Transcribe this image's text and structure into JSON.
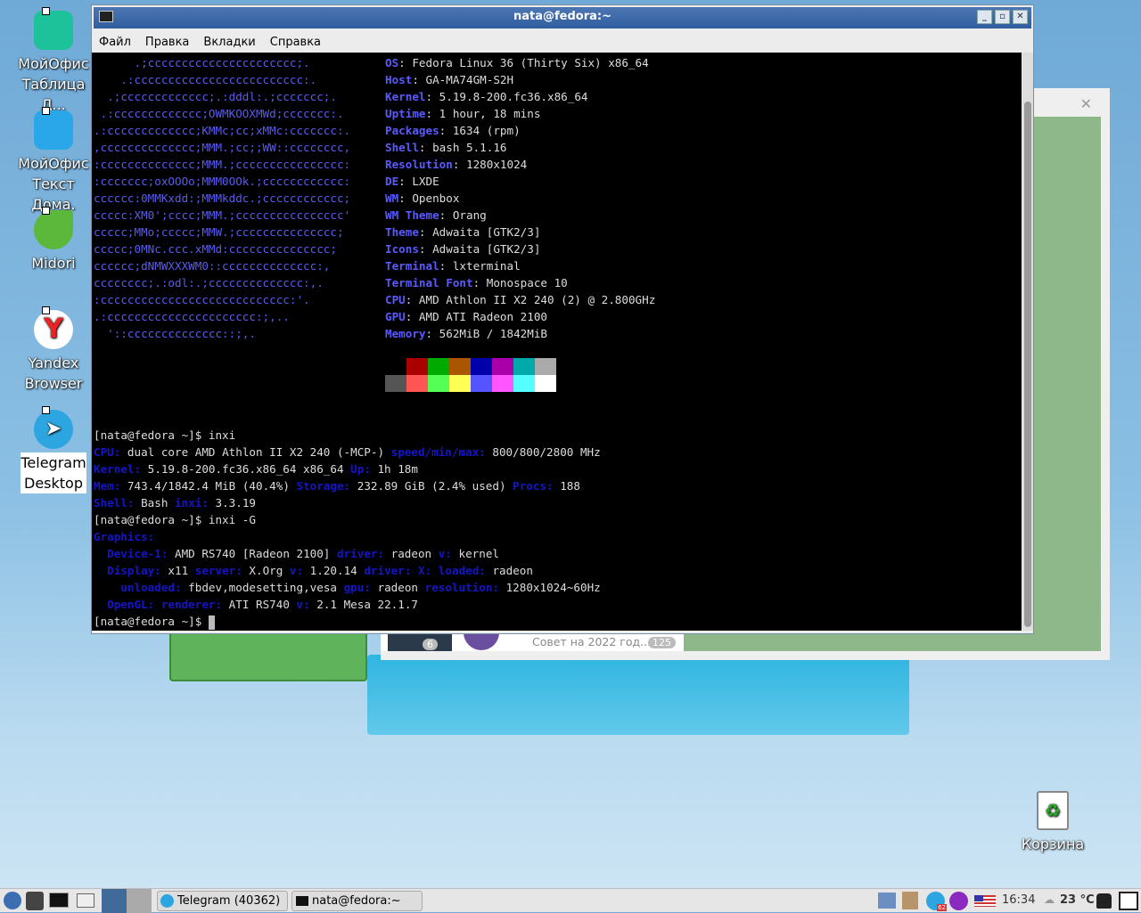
{
  "desktop": {
    "icons": [
      {
        "label": "МойОфис Таблица Д..."
      },
      {
        "label": "МойОфис Текст Дома."
      },
      {
        "label": "Midori"
      },
      {
        "label": "Yandex Browser"
      },
      {
        "label": "Telegram Desktop"
      }
    ],
    "trash": "Корзина"
  },
  "background_window": {
    "chat_preview": "Совет на 2022 год...",
    "badge": "125",
    "badge2": "6"
  },
  "terminal": {
    "title": "nata@fedora:~",
    "menu": [
      "Файл",
      "Правка",
      "Вкладки",
      "Справка"
    ],
    "ascii": [
      "      .;cccccccccccccccccccccc;.",
      "    .:ccccccccccccccccccccccccc:.",
      "  .;ccccccccccccc;.:dddl:.;ccccccc;.",
      " .:ccccccccccccc;OWMKOOXMWd;ccccccc:.",
      ".:ccccccccccccc;KMMc;cc;xMMc:ccccccc:.",
      ",cccccccccccccc;MMM.;cc;;WW::cccccccc,",
      ":cccccccccccccc;MMM.;cccccccccccccccc:",
      ":ccccccc;oxOOOo;MMM0OOk.;cccccccccccc:",
      "cccccc:0MMKxdd:;MMMkddc.;cccccccccccc;",
      "ccccc:XM0';cccc;MMM.;cccccccccccccccc'",
      "ccccc;MMo;ccccc;MMW.;ccccccccccccccc;",
      "ccccc;0MNc.ccc.xMMd:ccccccccccccccc;",
      "cccccc;dNMWXXXWM0::cccccccccccccc:,",
      "cccccccc;.:odl:.;cccccccccccccc:,.",
      ":cccccccccccccccccccccccccccc:'.",
      ".:cccccccccccccccccccccc:;,..",
      "  '::cccccccccccccc::;,."
    ],
    "info": [
      [
        "OS",
        "Fedora Linux 36 (Thirty Six) x86_64"
      ],
      [
        "Host",
        "GA-MA74GM-S2H"
      ],
      [
        "Kernel",
        "5.19.8-200.fc36.x86_64"
      ],
      [
        "Uptime",
        "1 hour, 18 mins"
      ],
      [
        "Packages",
        "1634 (rpm)"
      ],
      [
        "Shell",
        "bash 5.1.16"
      ],
      [
        "Resolution",
        "1280x1024"
      ],
      [
        "DE",
        "LXDE"
      ],
      [
        "WM",
        "Openbox"
      ],
      [
        "WM Theme",
        "Orang"
      ],
      [
        "Theme",
        "Adwaita [GTK2/3]"
      ],
      [
        "Icons",
        "Adwaita [GTK2/3]"
      ],
      [
        "Terminal",
        "lxterminal"
      ],
      [
        "Terminal Font",
        "Monospace 10"
      ],
      [
        "CPU",
        "AMD Athlon II X2 240 (2) @ 2.800GHz"
      ],
      [
        "GPU",
        "AMD ATI Radeon 2100"
      ],
      [
        "Memory",
        "562MiB / 1842MiB"
      ]
    ],
    "palette": [
      "#000000",
      "#aa0000",
      "#00aa00",
      "#aa5500",
      "#0000aa",
      "#aa00aa",
      "#00aaaa",
      "#aaaaaa",
      "#555555",
      "#ff5555",
      "#55ff55",
      "#ffff55",
      "#5555ff",
      "#ff55ff",
      "#55ffff",
      "#ffffff"
    ],
    "output": [
      [
        [
          "t",
          "[nata@fedora ~]$ inxi"
        ]
      ],
      [
        [
          "b",
          "CPU:"
        ],
        [
          "t",
          " dual core AMD Athlon II X2 240 (-MCP-) "
        ],
        [
          "b",
          "speed/min/max:"
        ],
        [
          "t",
          " 800/800/2800 MHz"
        ]
      ],
      [
        [
          "b",
          "Kernel:"
        ],
        [
          "t",
          " 5.19.8-200.fc36.x86_64 x86_64 "
        ],
        [
          "b",
          "Up:"
        ],
        [
          "t",
          " 1h 18m"
        ]
      ],
      [
        [
          "b",
          "Mem:"
        ],
        [
          "t",
          " 743.4/1842.4 MiB (40.4%) "
        ],
        [
          "b",
          "Storage:"
        ],
        [
          "t",
          " 232.89 GiB (2.4% used) "
        ],
        [
          "b",
          "Procs:"
        ],
        [
          "t",
          " 188"
        ]
      ],
      [
        [
          "b",
          "Shell:"
        ],
        [
          "t",
          " Bash "
        ],
        [
          "b",
          "inxi:"
        ],
        [
          "t",
          " 3.3.19"
        ]
      ],
      [
        [
          "t",
          "[nata@fedora ~]$ inxi -G"
        ]
      ],
      [
        [
          "b",
          "Graphics:"
        ]
      ],
      [
        [
          "t",
          "  "
        ],
        [
          "b",
          "Device-1:"
        ],
        [
          "t",
          " AMD RS740 [Radeon 2100] "
        ],
        [
          "b",
          "driver:"
        ],
        [
          "t",
          " radeon "
        ],
        [
          "b",
          "v:"
        ],
        [
          "t",
          " kernel"
        ]
      ],
      [
        [
          "t",
          "  "
        ],
        [
          "b",
          "Display:"
        ],
        [
          "t",
          " x11 "
        ],
        [
          "b",
          "server:"
        ],
        [
          "t",
          " X.Org "
        ],
        [
          "b",
          "v:"
        ],
        [
          "t",
          " 1.20.14 "
        ],
        [
          "b",
          "driver:"
        ],
        [
          "t",
          " "
        ],
        [
          "b",
          "X:"
        ],
        [
          "t",
          " "
        ],
        [
          "b",
          "loaded:"
        ],
        [
          "t",
          " radeon"
        ]
      ],
      [
        [
          "t",
          "    "
        ],
        [
          "b",
          "unloaded:"
        ],
        [
          "t",
          " fbdev,modesetting,vesa "
        ],
        [
          "b",
          "gpu:"
        ],
        [
          "t",
          " radeon "
        ],
        [
          "b",
          "resolution:"
        ],
        [
          "t",
          " 1280x1024~60Hz"
        ]
      ],
      [
        [
          "t",
          "  "
        ],
        [
          "b",
          "OpenGL:"
        ],
        [
          "t",
          " "
        ],
        [
          "b",
          "renderer:"
        ],
        [
          "t",
          " ATI RS740 "
        ],
        [
          "b",
          "v:"
        ],
        [
          "t",
          " 2.1 Mesa 22.1.7"
        ]
      ],
      [
        [
          "t",
          "[nata@fedora ~]$ "
        ]
      ]
    ]
  },
  "taskbar": {
    "tasks": [
      "Telegram (40362)",
      "nata@fedora:~"
    ],
    "clock": "16:34",
    "weather": "23 °C",
    "tg_badge": "62"
  }
}
